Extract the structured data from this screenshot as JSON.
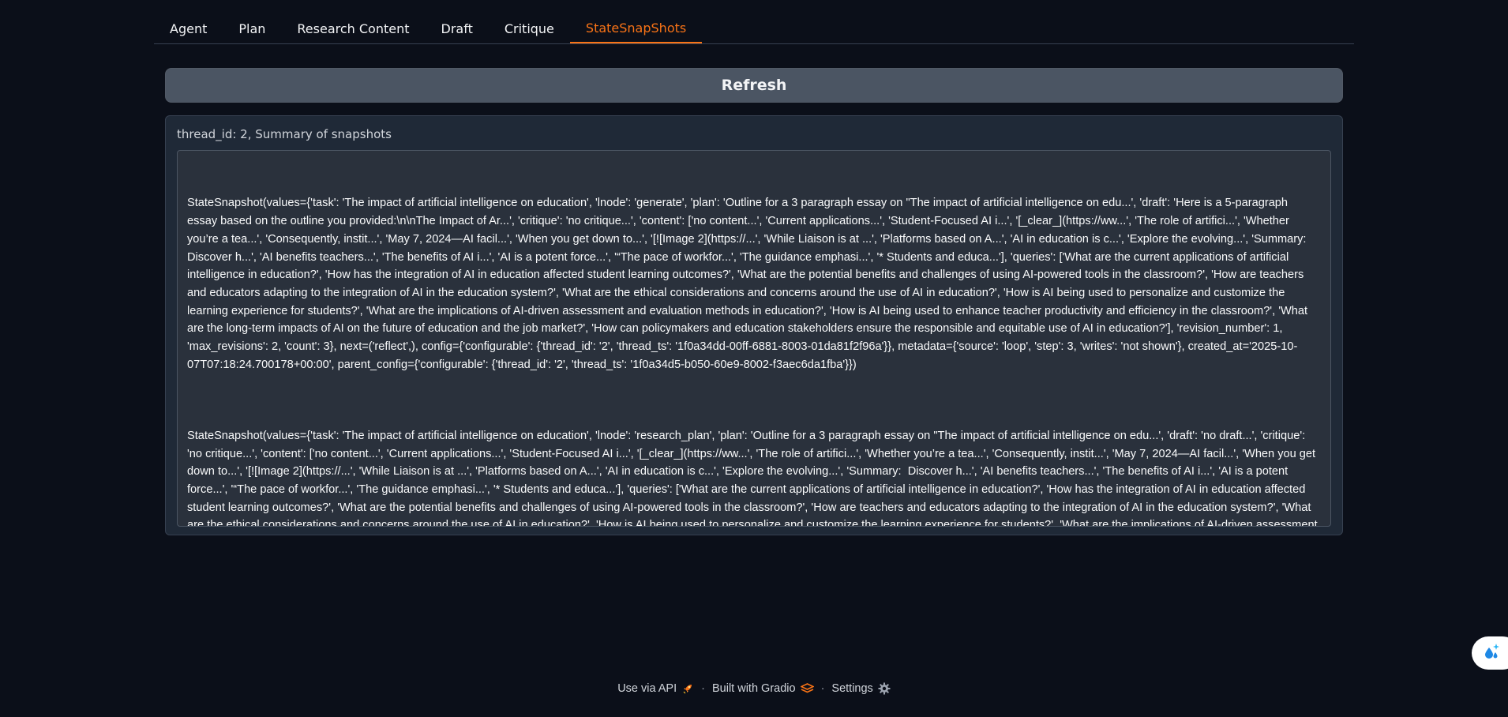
{
  "tabs": [
    {
      "label": "Agent"
    },
    {
      "label": "Plan"
    },
    {
      "label": "Research Content"
    },
    {
      "label": "Draft"
    },
    {
      "label": "Critique"
    },
    {
      "label": "StateSnapShots"
    }
  ],
  "selected_tab": "StateSnapShots",
  "refresh_label": "Refresh",
  "panel": {
    "label": "thread_id: 2, Summary of snapshots",
    "snapshots": [
      "StateSnapshot(values={'task': 'The impact of artificial intelligence on education', 'lnode': 'generate', 'plan': 'Outline for a 3 paragraph essay on \"The impact of artificial intelligence on edu...', 'draft': 'Here is a 5-paragraph essay based on the outline you provided:\\n\\nThe Impact of Ar...', 'critique': 'no critique...', 'content': ['no content...', 'Current applications...', 'Student-Focused AI i...', '[_clear_](https://ww...', 'The role of artifici...', 'Whether you’re a tea...', 'Consequently, instit...', 'May 7, 2024—AI facil...', 'When you get down to...', '[![Image 2](https://...', 'While Liaison is at ...', 'Platforms based on A...', 'AI in education is c...', 'Explore the evolving...', 'Summary:  Discover h...', 'AI benefits teachers...', 'The benefits of AI i...', 'AI is a potent force...', '“The pace of workfor...', 'The guidance emphasi...', '* Students and educa...'], 'queries': ['What are the current applications of artificial intelligence in education?', 'How has the integration of AI in education affected student learning outcomes?', 'What are the potential benefits and challenges of using AI-powered tools in the classroom?', 'How are teachers and educators adapting to the integration of AI in the education system?', 'What are the ethical considerations and concerns around the use of AI in education?', 'How is AI being used to personalize and customize the learning experience for students?', 'What are the implications of AI-driven assessment and evaluation methods in education?', 'How is AI being used to enhance teacher productivity and efficiency in the classroom?', 'What are the long-term impacts of AI on the future of education and the job market?', 'How can policymakers and education stakeholders ensure the responsible and equitable use of AI in education?'], 'revision_number': 1, 'max_revisions': 2, 'count': 3}, next=('reflect',), config={'configurable': {'thread_id': '2', 'thread_ts': '1f0a34dd-00ff-6881-8003-01da81f2f96a'}}, metadata={'source': 'loop', 'step': 3, 'writes': 'not shown'}, created_at='2025-10-07T07:18:24.700178+00:00', parent_config={'configurable': {'thread_id': '2', 'thread_ts': '1f0a34d5-b050-60e9-8002-f3aec6da1fba'}})",
      "StateSnapshot(values={'task': 'The impact of artificial intelligence on education', 'lnode': 'research_plan', 'plan': 'Outline for a 3 paragraph essay on \"The impact of artificial intelligence on edu...', 'draft': 'no draft...', 'critique': 'no critique...', 'content': ['no content...', 'Current applications...', 'Student-Focused AI i...', '[_clear_](https://ww...', 'The role of artifici...', 'Whether you’re a tea...', 'Consequently, instit...', 'May 7, 2024—AI facil...', 'When you get down to...', '[![Image 2](https://...', 'While Liaison is at ...', 'Platforms based on A...', 'AI in education is c...', 'Explore the evolving...', 'Summary:  Discover h...', 'AI benefits teachers...', 'The benefits of AI i...', 'AI is a potent force...', '“The pace of workfor...', 'The guidance emphasi...', '* Students and educa...'], 'queries': ['What are the current applications of artificial intelligence in education?', 'How has the integration of AI in education affected student learning outcomes?', 'What are the potential benefits and challenges of using AI-powered tools in the classroom?', 'How are teachers and educators adapting to the integration of AI in the education system?', 'What are the ethical considerations and concerns around the use of AI in education?', 'How is AI being used to personalize and customize the learning experience for students?', 'What are the implications of AI-driven assessment and evaluation methods in education?', 'How is AI being used to enhance teacher productivity and efficiency in the classroom?', 'What are the long-term impacts of AI on the future of education and the job market?', 'How can policymakers and education stakeholders ensure the responsible and equitable use of AI in education?'], 'revision_number': 0, 'max_revisions': 2, 'count': 2}, next=('generate',), config={'configurable': {'thread_id': '2', 'thread_ts': '1f0a34d5-b050-60e9-8002-f3aec6da1fba'}}, metadata={'source': 'loop', 'step': 2, 'writes': 'not shown'}, created_at='2025-10-07T07:15:00.324962+00:00', parent_config={'configurable': {'thread_id': '2', 'thread_ts': '1f0a34d5-9a1a-60c0-8001-07762903ba7e'}})"
    ]
  },
  "footer": {
    "api_label": "Use via API",
    "built_label": "Built with Gradio",
    "settings_label": "Settings",
    "separator": "·"
  },
  "icons": {
    "api": "rocket-icon",
    "gradio": "gradio-logo-icon",
    "settings": "gear-icon",
    "float": "droplets-sparkle-icon"
  },
  "colors": {
    "background": "#0b0f19",
    "accent": "#f97316",
    "button": "#4b5563",
    "panel": "#1f2937",
    "textarea": "#2a313c"
  }
}
